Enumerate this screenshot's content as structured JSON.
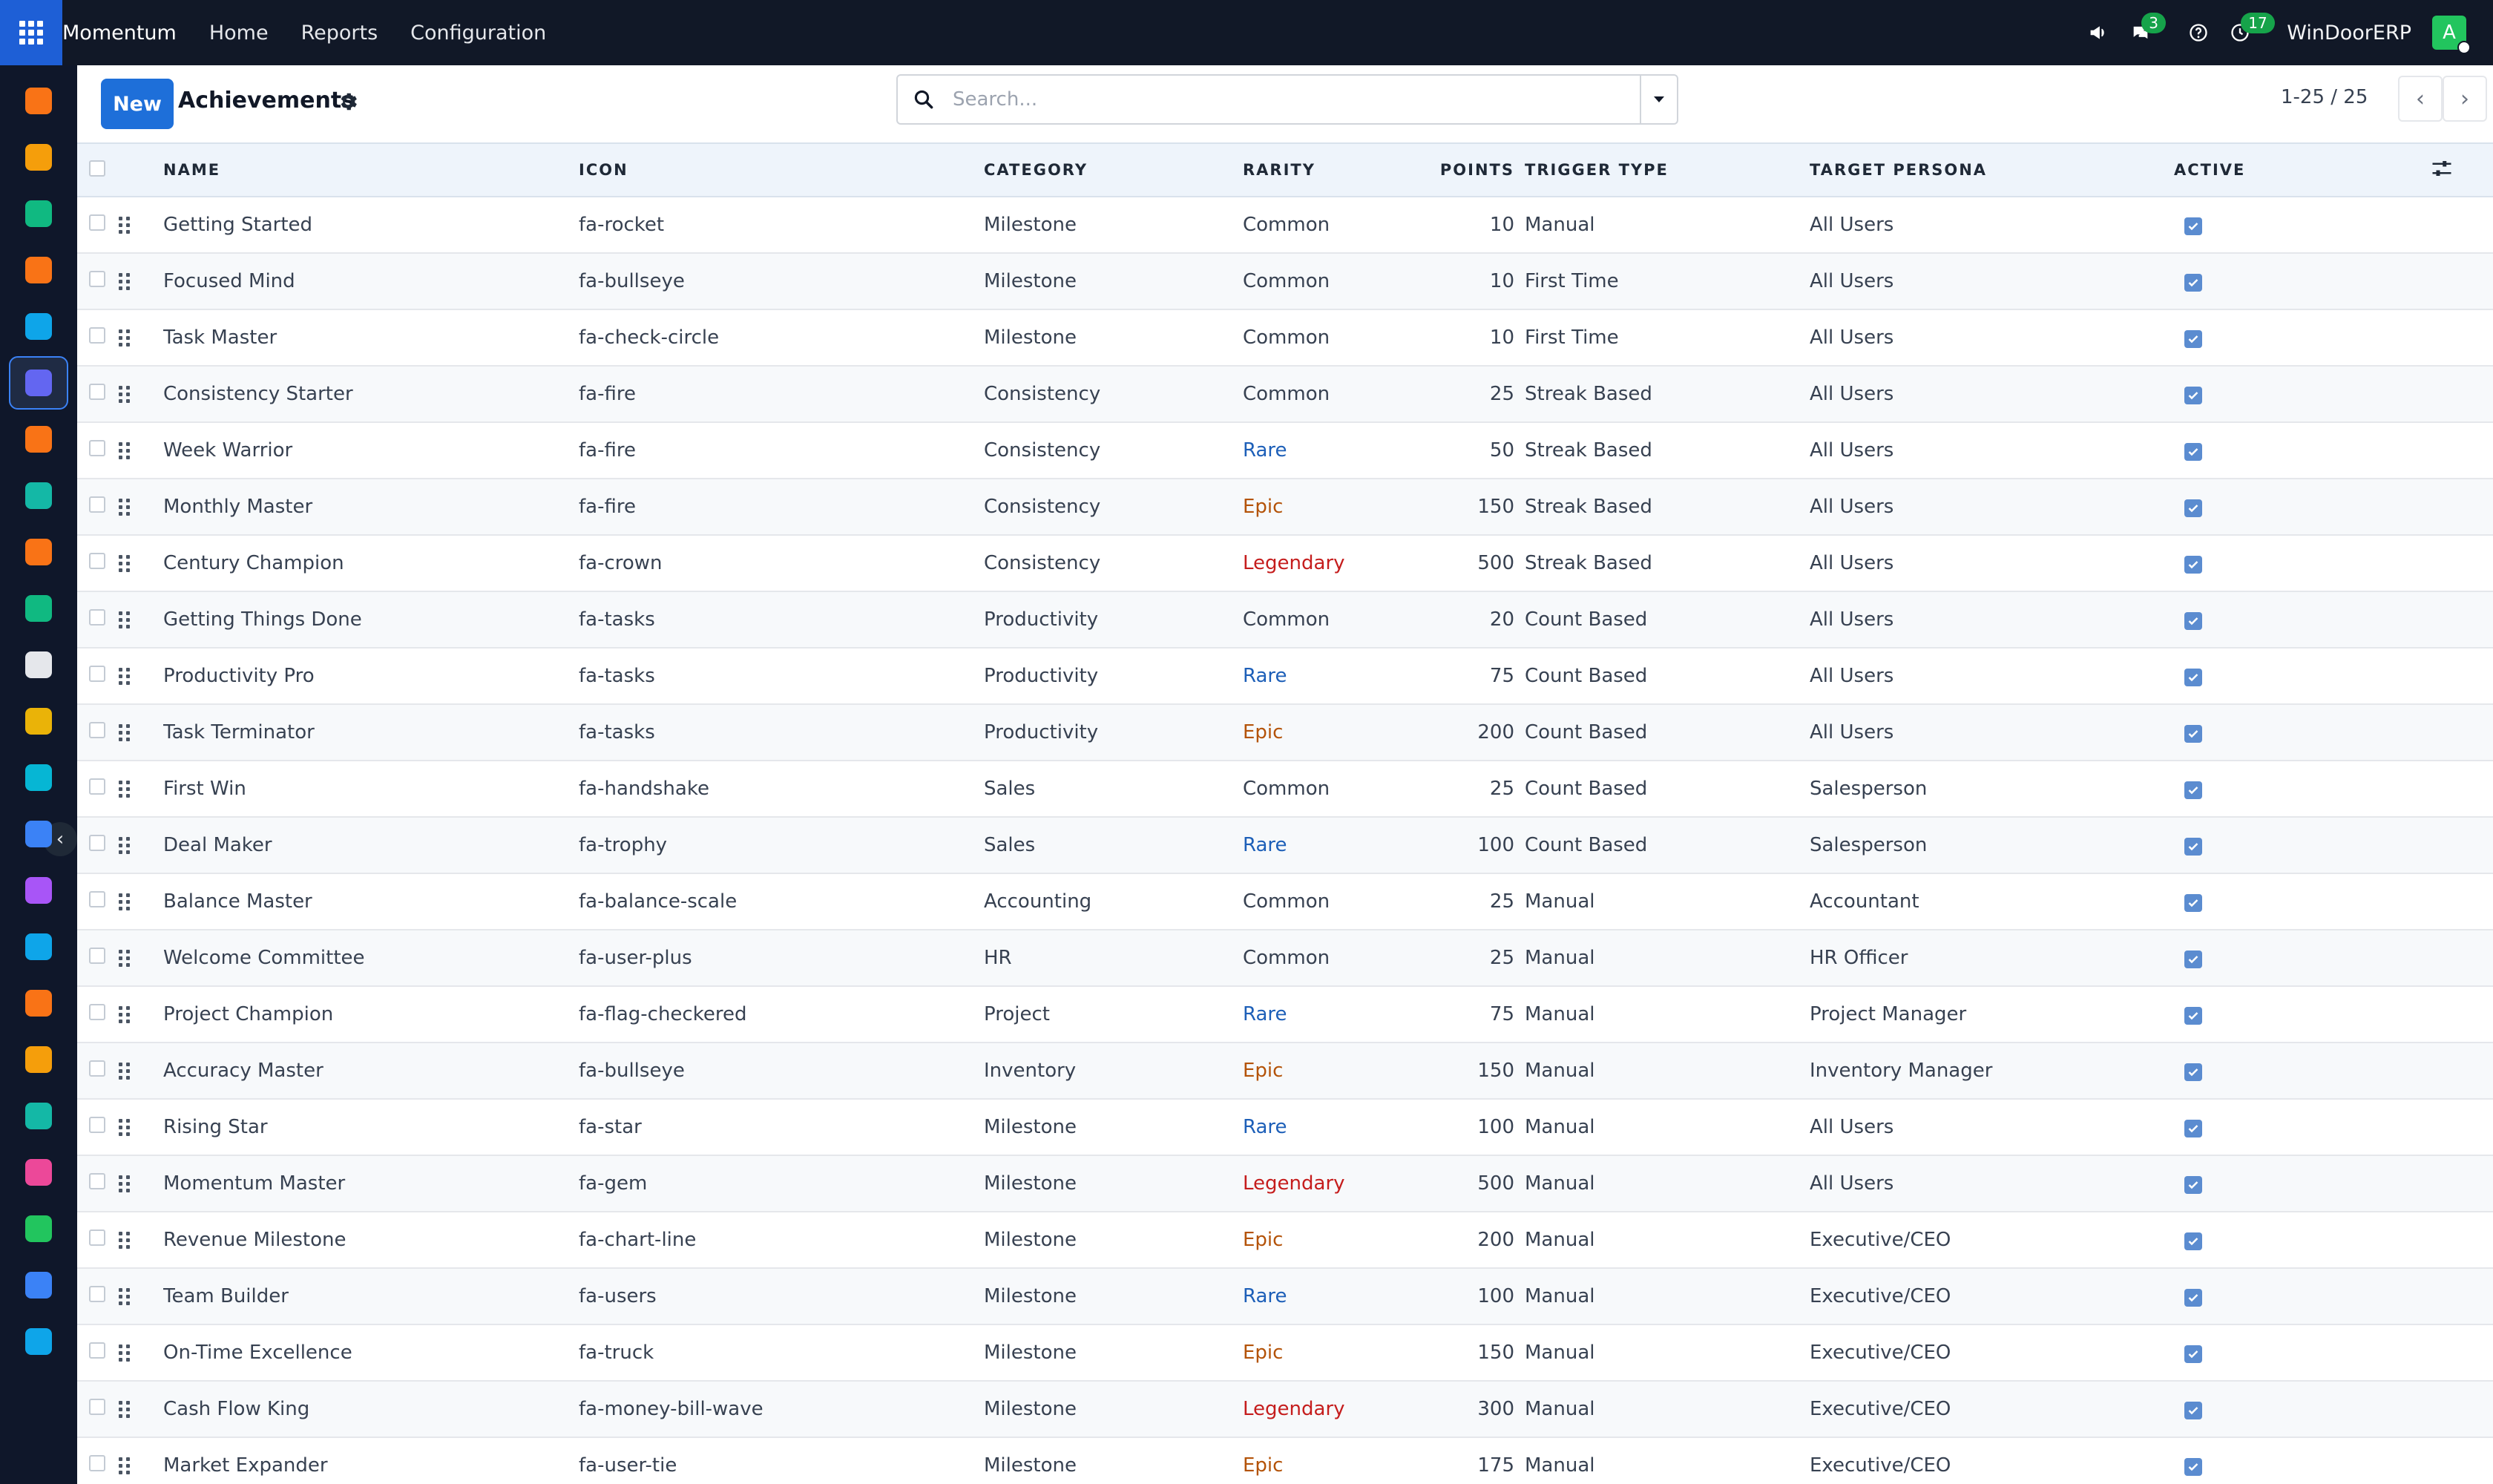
{
  "navbar": {
    "brand": "Momentum",
    "links": [
      "Home",
      "Reports",
      "Configuration"
    ],
    "messages_count": "3",
    "activities_count": "17",
    "company": "WinDoorERP",
    "avatar_initial": "A"
  },
  "dock": {
    "icons": [
      {
        "name": "dashboards-icon",
        "color": "#f97316"
      },
      {
        "name": "knowledge-icon",
        "color": "#f59e0b"
      },
      {
        "name": "contacts-icon",
        "color": "#10b981"
      },
      {
        "name": "discuss-icon",
        "color": "#f97316"
      },
      {
        "name": "sales-icon",
        "color": "#0ea5e9"
      },
      {
        "name": "momentum-icon",
        "color": "#6366f1"
      },
      {
        "name": "chat-icon",
        "color": "#f97316"
      },
      {
        "name": "project-icon",
        "color": "#14b8a6"
      },
      {
        "name": "reporting-icon",
        "color": "#f97316"
      },
      {
        "name": "employees-icon",
        "color": "#10b981"
      },
      {
        "name": "inventory-icon",
        "color": "#e5e7eb"
      },
      {
        "name": "helpdesk-icon",
        "color": "#eab308"
      },
      {
        "name": "todo-icon",
        "color": "#06b6d4"
      },
      {
        "name": "elearning-icon",
        "color": "#3b82f6"
      },
      {
        "name": "manufacturing-icon",
        "color": "#a855f7"
      },
      {
        "name": "invoicing-icon",
        "color": "#0ea5e9"
      },
      {
        "name": "team-icon",
        "color": "#f97316"
      },
      {
        "name": "calendar-icon",
        "color": "#f59e0b"
      },
      {
        "name": "sign-icon",
        "color": "#14b8a6"
      },
      {
        "name": "apps-icon",
        "color": "#ec4899"
      },
      {
        "name": "whatsapp-icon",
        "color": "#22c55e"
      },
      {
        "name": "timesheet-icon",
        "color": "#3b82f6"
      },
      {
        "name": "crm-icon",
        "color": "#0ea5e9"
      }
    ]
  },
  "control": {
    "new_label": "New",
    "title": "Achievements",
    "search_placeholder": "Search...",
    "pager": "1-25 / 25"
  },
  "table": {
    "headers": {
      "name": "NAME",
      "icon": "ICON",
      "category": "CATEGORY",
      "rarity": "RARITY",
      "points": "POINTS",
      "trigger": "TRIGGER TYPE",
      "persona": "TARGET PERSONA",
      "active": "ACTIVE"
    },
    "rows": [
      {
        "name": "Getting Started",
        "icon": "fa-rocket",
        "category": "Milestone",
        "rarity": "Common",
        "points": "10",
        "trigger": "Manual",
        "persona": "All Users"
      },
      {
        "name": "Focused Mind",
        "icon": "fa-bullseye",
        "category": "Milestone",
        "rarity": "Common",
        "points": "10",
        "trigger": "First Time",
        "persona": "All Users"
      },
      {
        "name": "Task Master",
        "icon": "fa-check-circle",
        "category": "Milestone",
        "rarity": "Common",
        "points": "10",
        "trigger": "First Time",
        "persona": "All Users"
      },
      {
        "name": "Consistency Starter",
        "icon": "fa-fire",
        "category": "Consistency",
        "rarity": "Common",
        "points": "25",
        "trigger": "Streak Based",
        "persona": "All Users"
      },
      {
        "name": "Week Warrior",
        "icon": "fa-fire",
        "category": "Consistency",
        "rarity": "Rare",
        "points": "50",
        "trigger": "Streak Based",
        "persona": "All Users"
      },
      {
        "name": "Monthly Master",
        "icon": "fa-fire",
        "category": "Consistency",
        "rarity": "Epic",
        "points": "150",
        "trigger": "Streak Based",
        "persona": "All Users"
      },
      {
        "name": "Century Champion",
        "icon": "fa-crown",
        "category": "Consistency",
        "rarity": "Legendary",
        "points": "500",
        "trigger": "Streak Based",
        "persona": "All Users"
      },
      {
        "name": "Getting Things Done",
        "icon": "fa-tasks",
        "category": "Productivity",
        "rarity": "Common",
        "points": "20",
        "trigger": "Count Based",
        "persona": "All Users"
      },
      {
        "name": "Productivity Pro",
        "icon": "fa-tasks",
        "category": "Productivity",
        "rarity": "Rare",
        "points": "75",
        "trigger": "Count Based",
        "persona": "All Users"
      },
      {
        "name": "Task Terminator",
        "icon": "fa-tasks",
        "category": "Productivity",
        "rarity": "Epic",
        "points": "200",
        "trigger": "Count Based",
        "persona": "All Users"
      },
      {
        "name": "First Win",
        "icon": "fa-handshake",
        "category": "Sales",
        "rarity": "Common",
        "points": "25",
        "trigger": "Count Based",
        "persona": "Salesperson"
      },
      {
        "name": "Deal Maker",
        "icon": "fa-trophy",
        "category": "Sales",
        "rarity": "Rare",
        "points": "100",
        "trigger": "Count Based",
        "persona": "Salesperson"
      },
      {
        "name": "Balance Master",
        "icon": "fa-balance-scale",
        "category": "Accounting",
        "rarity": "Common",
        "points": "25",
        "trigger": "Manual",
        "persona": "Accountant"
      },
      {
        "name": "Welcome Committee",
        "icon": "fa-user-plus",
        "category": "HR",
        "rarity": "Common",
        "points": "25",
        "trigger": "Manual",
        "persona": "HR Officer"
      },
      {
        "name": "Project Champion",
        "icon": "fa-flag-checkered",
        "category": "Project",
        "rarity": "Rare",
        "points": "75",
        "trigger": "Manual",
        "persona": "Project Manager"
      },
      {
        "name": "Accuracy Master",
        "icon": "fa-bullseye",
        "category": "Inventory",
        "rarity": "Epic",
        "points": "150",
        "trigger": "Manual",
        "persona": "Inventory Manager"
      },
      {
        "name": "Rising Star",
        "icon": "fa-star",
        "category": "Milestone",
        "rarity": "Rare",
        "points": "100",
        "trigger": "Manual",
        "persona": "All Users"
      },
      {
        "name": "Momentum Master",
        "icon": "fa-gem",
        "category": "Milestone",
        "rarity": "Legendary",
        "points": "500",
        "trigger": "Manual",
        "persona": "All Users"
      },
      {
        "name": "Revenue Milestone",
        "icon": "fa-chart-line",
        "category": "Milestone",
        "rarity": "Epic",
        "points": "200",
        "trigger": "Manual",
        "persona": "Executive/CEO"
      },
      {
        "name": "Team Builder",
        "icon": "fa-users",
        "category": "Milestone",
        "rarity": "Rare",
        "points": "100",
        "trigger": "Manual",
        "persona": "Executive/CEO"
      },
      {
        "name": "On-Time Excellence",
        "icon": "fa-truck",
        "category": "Milestone",
        "rarity": "Epic",
        "points": "150",
        "trigger": "Manual",
        "persona": "Executive/CEO"
      },
      {
        "name": "Cash Flow King",
        "icon": "fa-money-bill-wave",
        "category": "Milestone",
        "rarity": "Legendary",
        "points": "300",
        "trigger": "Manual",
        "persona": "Executive/CEO"
      },
      {
        "name": "Market Expander",
        "icon": "fa-user-tie",
        "category": "Milestone",
        "rarity": "Epic",
        "points": "175",
        "trigger": "Manual",
        "persona": "Executive/CEO"
      }
    ]
  }
}
